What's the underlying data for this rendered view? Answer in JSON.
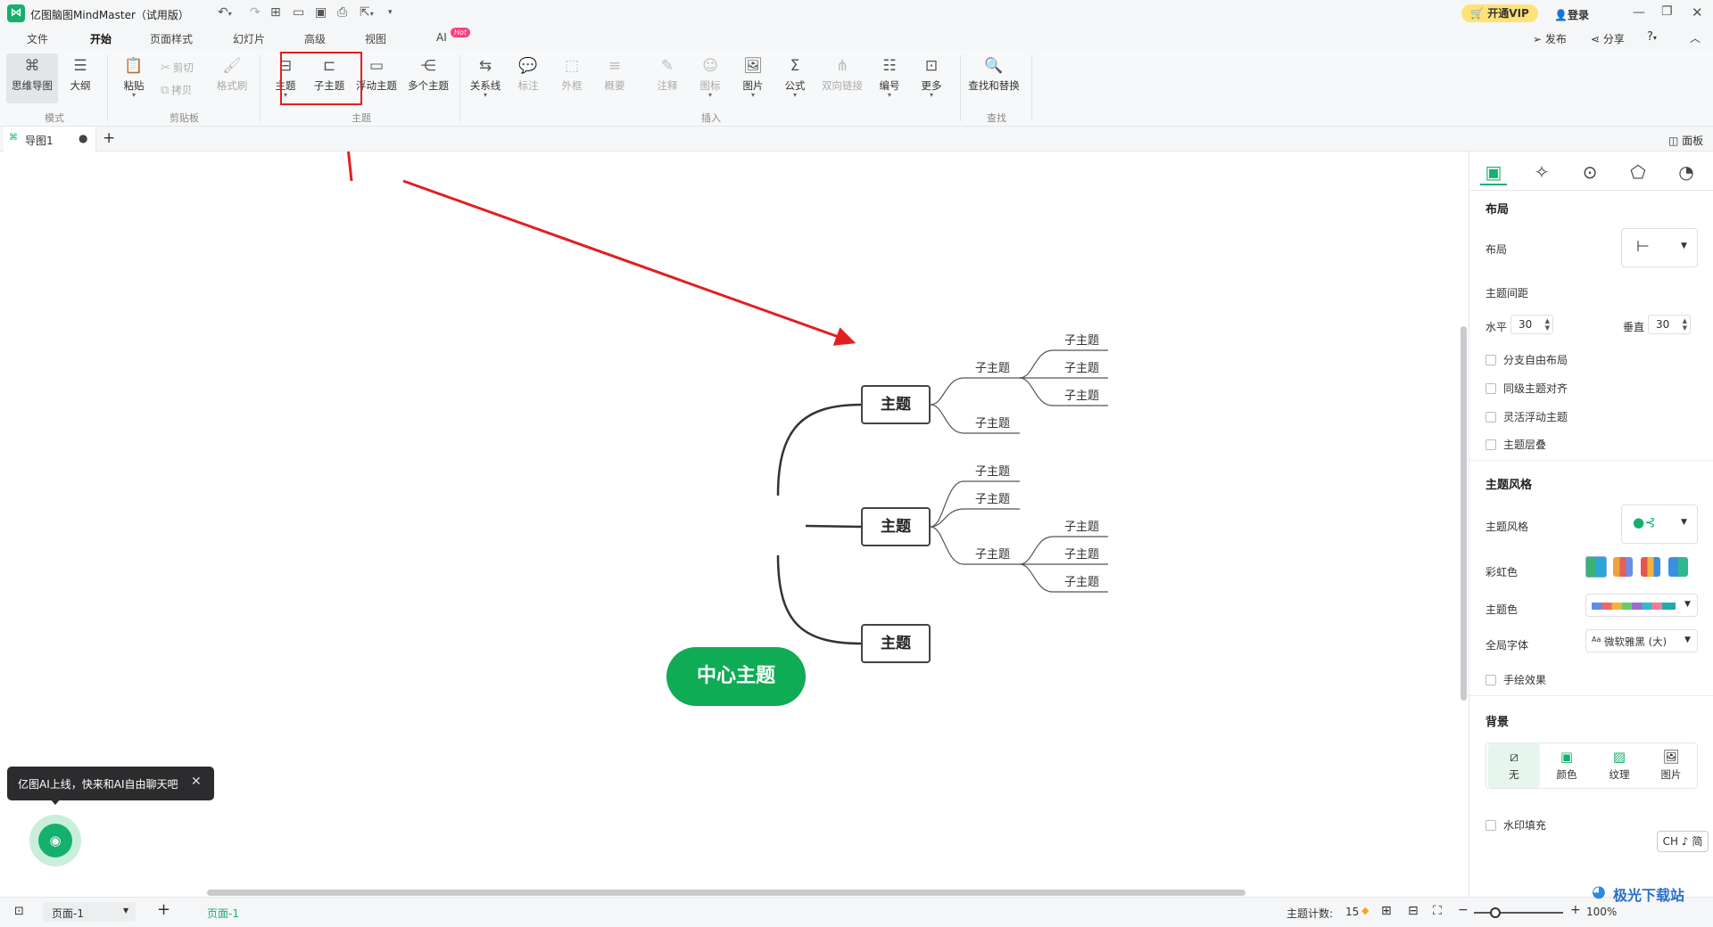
{
  "app": {
    "title": "亿图脑图MindMaster（试用版）",
    "vip_label": "开通VIP",
    "login_label": "登录"
  },
  "menu": {
    "tabs": [
      "文件",
      "开始",
      "页面样式",
      "幻灯片",
      "高级",
      "视图"
    ],
    "ai_label": "AI",
    "ai_badge": "Hot",
    "publish": "发布",
    "share": "分享"
  },
  "ribbon": {
    "mode": {
      "mindmap": "思维导图",
      "outline": "大纲",
      "group": "模式"
    },
    "clipboard": {
      "paste": "粘贴",
      "cut": "剪切",
      "copy": "拷贝",
      "format_painter": "格式刷",
      "group": "剪贴板"
    },
    "topic": {
      "topic": "主题",
      "subtopic": "子主题",
      "floating": "浮动主题",
      "multiple": "多个主题",
      "group": "主题"
    },
    "insert": {
      "relation": "关系线",
      "callout": "标注",
      "boundary": "外框",
      "summary": "概要",
      "note": "注释",
      "icon": "图标",
      "image": "图片",
      "formula": "公式",
      "crosslink": "双向链接",
      "numbering": "编号",
      "more": "更多",
      "group": "插入"
    },
    "find": {
      "find_replace": "查找和替换",
      "group": "查找"
    }
  },
  "doc_tab": {
    "name": "导图1",
    "panel_label": "面板"
  },
  "mindmap": {
    "center": "中心主题",
    "main_topics": [
      "主题",
      "主题",
      "主题"
    ],
    "subtopic_label": "子主题"
  },
  "ai_tip": "亿图AI上线，快来和AI自由聊天吧",
  "panel": {
    "layout_header": "布局",
    "layout_label": "布局",
    "spacing_label": "主题间距",
    "horizontal_label": "水平",
    "horizontal_value": "30",
    "vertical_label": "垂直",
    "vertical_value": "30",
    "checks1": [
      "分支自由布局",
      "同级主题对齐",
      "灵活浮动主题",
      "主题层叠"
    ],
    "style_header": "主题风格",
    "style_label": "主题风格",
    "rainbow_label": "彩虹色",
    "theme_color_label": "主题色",
    "font_label": "全局字体",
    "font_value": "微软雅黑 (大)",
    "handdrawn_label": "手绘效果",
    "bg_header": "背景",
    "bg_options": [
      "无",
      "颜色",
      "纹理",
      "图片"
    ],
    "watermark_label": "水印填充",
    "ime": "CH ♪ 简"
  },
  "status": {
    "page_select": "页面-1",
    "page_tab": "页面-1",
    "topic_count_label": "主题计数:",
    "topic_count": "15",
    "zoom": "100%"
  },
  "watermark": "极光下载站",
  "colors": {
    "accent": "#15b06e",
    "center_node": "#0fac55",
    "annotation": "#e02020"
  }
}
